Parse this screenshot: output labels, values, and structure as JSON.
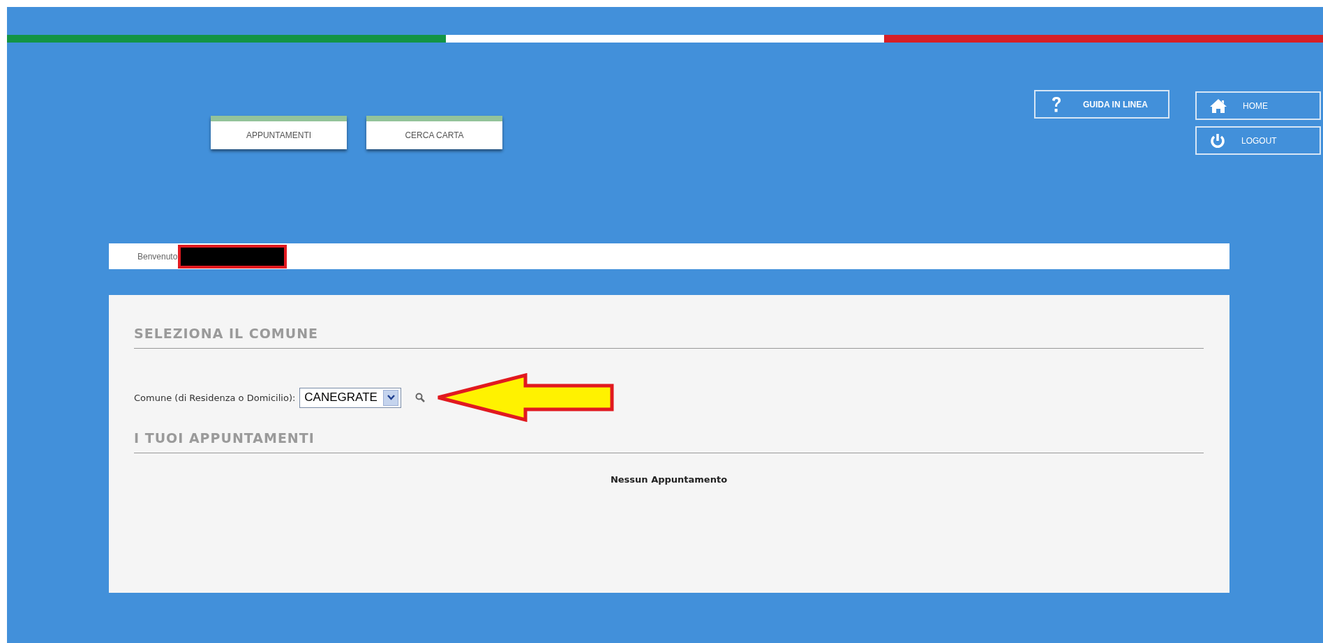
{
  "nav_buttons": [
    {
      "label": "APPUNTAMENTI"
    },
    {
      "label": "CERCA CARTA"
    }
  ],
  "help_button": {
    "label": "GUIDA IN LINEA"
  },
  "account_buttons": [
    {
      "kind": "home",
      "label": "HOME"
    },
    {
      "kind": "logout",
      "label": "LOGOUT"
    }
  ],
  "welcome_bar": {
    "text": "Benvenuto",
    "name_redacted": true
  },
  "sections": [
    {
      "title": "SELEZIONA IL COMUNE",
      "field": {
        "label": "Comune (di Residenza o Domicilio):",
        "value": "CANEGRATE"
      },
      "annotation_arrow": true
    },
    {
      "title": "I TUOI APPUNTAMENTI",
      "empty_message": "Nessun Appuntamento"
    }
  ]
}
